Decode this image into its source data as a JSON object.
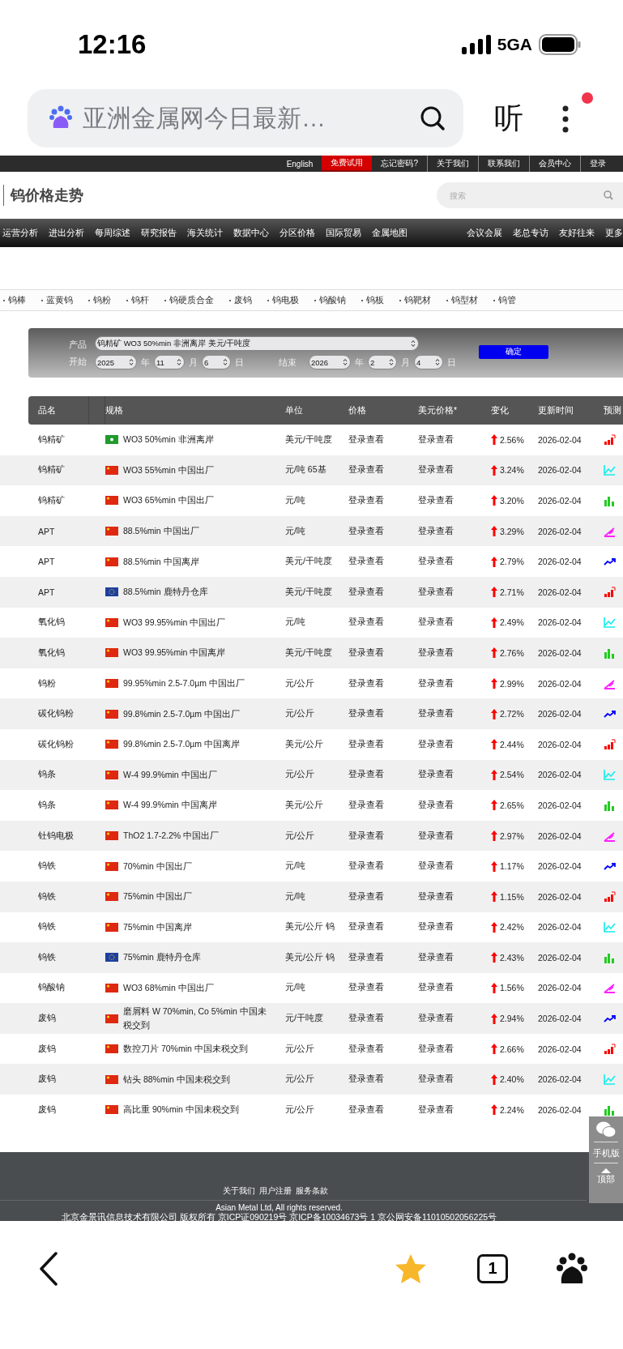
{
  "status_bar": {
    "time": "12:16",
    "network": "5GA"
  },
  "browser": {
    "address": "亚洲金属网今日最新…",
    "listen": "听"
  },
  "top_links": [
    {
      "label": "English",
      "highlighted": false
    },
    {
      "label": "免费试用",
      "highlighted": true
    },
    {
      "label": "忘记密码?",
      "highlighted": false
    },
    {
      "label": "关于我们",
      "highlighted": false
    },
    {
      "label": "联系我们",
      "highlighted": false
    },
    {
      "label": "会员中心",
      "highlighted": false
    },
    {
      "label": "登录",
      "highlighted": false
    }
  ],
  "page_title": "钨价格走势",
  "search": {
    "placeholder": "搜索"
  },
  "nav_left": [
    "运营分析",
    "进出分析",
    "每周综述",
    "研究报告",
    "海关统计",
    "数据中心",
    "分区价格",
    "国际贸易",
    "金属地图"
  ],
  "nav_right": [
    "会议会展",
    "老总专访",
    "友好往来",
    "更多"
  ],
  "categories": [
    "钨棒",
    "蓝黄钨",
    "钨粉",
    "钨杆",
    "钨硬质合金",
    "废钨",
    "钨电极",
    "钨酸钠",
    "钨板",
    "钨靶材",
    "钨型材",
    "钨管"
  ],
  "form": {
    "product_label": "产品",
    "product": "钨精矿 WO3 50%min 非洲离岸 美元/干吨度",
    "start_label": "开始",
    "start": [
      {
        "value": "2025",
        "unit": "年"
      },
      {
        "value": "11",
        "unit": "月"
      },
      {
        "value": "6",
        "unit": "日"
      }
    ],
    "end_label": "结束",
    "end": [
      {
        "value": "2026",
        "unit": "年"
      },
      {
        "value": "2",
        "unit": "月"
      },
      {
        "value": "4",
        "unit": "日"
      }
    ],
    "button": "确定"
  },
  "table": {
    "columns": [
      "品名",
      "规格",
      "单位",
      "价格",
      "美元价格*",
      "变化",
      "更新时间",
      "预测"
    ],
    "rows": [
      {
        "name": "钨精矿",
        "kind": "africa",
        "spec": "WO3 50%min 非洲离岸",
        "unit": "美元/干吨度",
        "price": "登录查看",
        "usd_price": "登录查看",
        "change": "2.56%",
        "date": "2026-02-04"
      },
      {
        "name": "钨精矿",
        "kind": "cn",
        "spec": "WO3 55%min 中国出厂",
        "unit": "元/吨 65基",
        "price": "登录查看",
        "usd_price": "登录查看",
        "change": "3.24%",
        "date": "2026-02-04"
      },
      {
        "name": "钨精矿",
        "kind": "cn",
        "spec": "WO3 65%min 中国出厂",
        "unit": "元/吨",
        "price": "登录查看",
        "usd_price": "登录查看",
        "change": "3.20%",
        "date": "2026-02-04"
      },
      {
        "name": "APT",
        "kind": "cn",
        "spec": "88.5%min 中国出厂",
        "unit": "元/吨",
        "price": "登录查看",
        "usd_price": "登录查看",
        "change": "3.29%",
        "date": "2026-02-04"
      },
      {
        "name": "APT",
        "kind": "cn",
        "spec": "88.5%min 中国离岸",
        "unit": "美元/干吨度",
        "price": "登录查看",
        "usd_price": "登录查看",
        "change": "2.79%",
        "date": "2026-02-04"
      },
      {
        "name": "APT",
        "kind": "eu",
        "spec": "88.5%min 鹿特丹仓库",
        "unit": "美元/干吨度",
        "price": "登录查看",
        "usd_price": "登录查看",
        "change": "2.71%",
        "date": "2026-02-04"
      },
      {
        "name": "氧化钨",
        "kind": "cn",
        "spec": "WO3 99.95%min 中国出厂",
        "unit": "元/吨",
        "price": "登录查看",
        "usd_price": "登录查看",
        "change": "2.49%",
        "date": "2026-02-04"
      },
      {
        "name": "氧化钨",
        "kind": "cn",
        "spec": "WO3 99.95%min 中国离岸",
        "unit": "美元/干吨度",
        "price": "登录查看",
        "usd_price": "登录查看",
        "change": "2.76%",
        "date": "2026-02-04"
      },
      {
        "name": "钨粉",
        "kind": "cn",
        "spec": "99.95%min 2.5-7.0µm 中国出厂",
        "unit": "元/公斤",
        "price": "登录查看",
        "usd_price": "登录查看",
        "change": "2.99%",
        "date": "2026-02-04"
      },
      {
        "name": "碳化钨粉",
        "kind": "cn",
        "spec": "99.8%min 2.5-7.0µm 中国出厂",
        "unit": "元/公斤",
        "price": "登录查看",
        "usd_price": "登录查看",
        "change": "2.72%",
        "date": "2026-02-04"
      },
      {
        "name": "碳化钨粉",
        "kind": "cn",
        "spec": "99.8%min 2.5-7.0µm 中国离岸",
        "unit": "美元/公斤",
        "price": "登录查看",
        "usd_price": "登录查看",
        "change": "2.44%",
        "date": "2026-02-04"
      },
      {
        "name": "钨条",
        "kind": "cn",
        "spec": "W-4 99.9%min 中国出厂",
        "unit": "元/公斤",
        "price": "登录查看",
        "usd_price": "登录查看",
        "change": "2.54%",
        "date": "2026-02-04"
      },
      {
        "name": "钨条",
        "kind": "cn",
        "spec": "W-4 99.9%min 中国离岸",
        "unit": "美元/公斤",
        "price": "登录查看",
        "usd_price": "登录查看",
        "change": "2.65%",
        "date": "2026-02-04"
      },
      {
        "name": "钍钨电极",
        "kind": "cn",
        "spec": "ThO2 1.7-2.2% 中国出厂",
        "unit": "元/公斤",
        "price": "登录查看",
        "usd_price": "登录查看",
        "change": "2.97%",
        "date": "2026-02-04"
      },
      {
        "name": "钨铁",
        "kind": "cn",
        "spec": "70%min 中国出厂",
        "unit": "元/吨",
        "price": "登录查看",
        "usd_price": "登录查看",
        "change": "1.17%",
        "date": "2026-02-04"
      },
      {
        "name": "钨铁",
        "kind": "cn",
        "spec": "75%min 中国出厂",
        "unit": "元/吨",
        "price": "登录查看",
        "usd_price": "登录查看",
        "change": "1.15%",
        "date": "2026-02-04"
      },
      {
        "name": "钨铁",
        "kind": "cn",
        "spec": "75%min 中国离岸",
        "unit": "美元/公斤 钨",
        "price": "登录查看",
        "usd_price": "登录查看",
        "change": "2.42%",
        "date": "2026-02-04"
      },
      {
        "name": "钨铁",
        "kind": "eu",
        "spec": "75%min 鹿特丹仓库",
        "unit": "美元/公斤 钨",
        "price": "登录查看",
        "usd_price": "登录查看",
        "change": "2.43%",
        "date": "2026-02-04"
      },
      {
        "name": "钨酸钠",
        "kind": "cn",
        "spec": "WO3 68%min 中国出厂",
        "unit": "元/吨",
        "price": "登录查看",
        "usd_price": "登录查看",
        "change": "1.56%",
        "date": "2026-02-04"
      },
      {
        "name": "废钨",
        "kind": "cn",
        "spec": "磨屑料 W 70%min, Co 5%min 中国未税交到",
        "unit": "元/干吨度",
        "price": "登录查看",
        "usd_price": "登录查看",
        "change": "2.94%",
        "date": "2026-02-04"
      },
      {
        "name": "废钨",
        "kind": "cn",
        "spec": "数控刀片 70%min 中国未税交到",
        "unit": "元/公斤",
        "price": "登录查看",
        "usd_price": "登录查看",
        "change": "2.66%",
        "date": "2026-02-04"
      },
      {
        "name": "废钨",
        "kind": "cn",
        "spec": "钻头 88%min 中国未税交到",
        "unit": "元/公斤",
        "price": "登录查看",
        "usd_price": "登录查看",
        "change": "2.40%",
        "date": "2026-02-04"
      },
      {
        "name": "废钨",
        "kind": "cn",
        "spec": "高比重 90%min 中国未税交到",
        "unit": "元/公斤",
        "price": "登录查看",
        "usd_price": "登录查看",
        "change": "2.24%",
        "date": "2026-02-04"
      }
    ]
  },
  "side_panel": {
    "mobile": "手机版",
    "top": "顶部"
  },
  "footer": {
    "links": [
      "关于我们",
      "用户注册",
      "服务条款"
    ],
    "copyright": "Asian Metal Ltd, All rights reserved.",
    "license": "北京金景讯信息技术有限公司 版权所有 京ICP证090219号 京ICP备10034673号 1 京公网安备11010502056225号"
  },
  "toolbar": {
    "tab_count": "1"
  }
}
